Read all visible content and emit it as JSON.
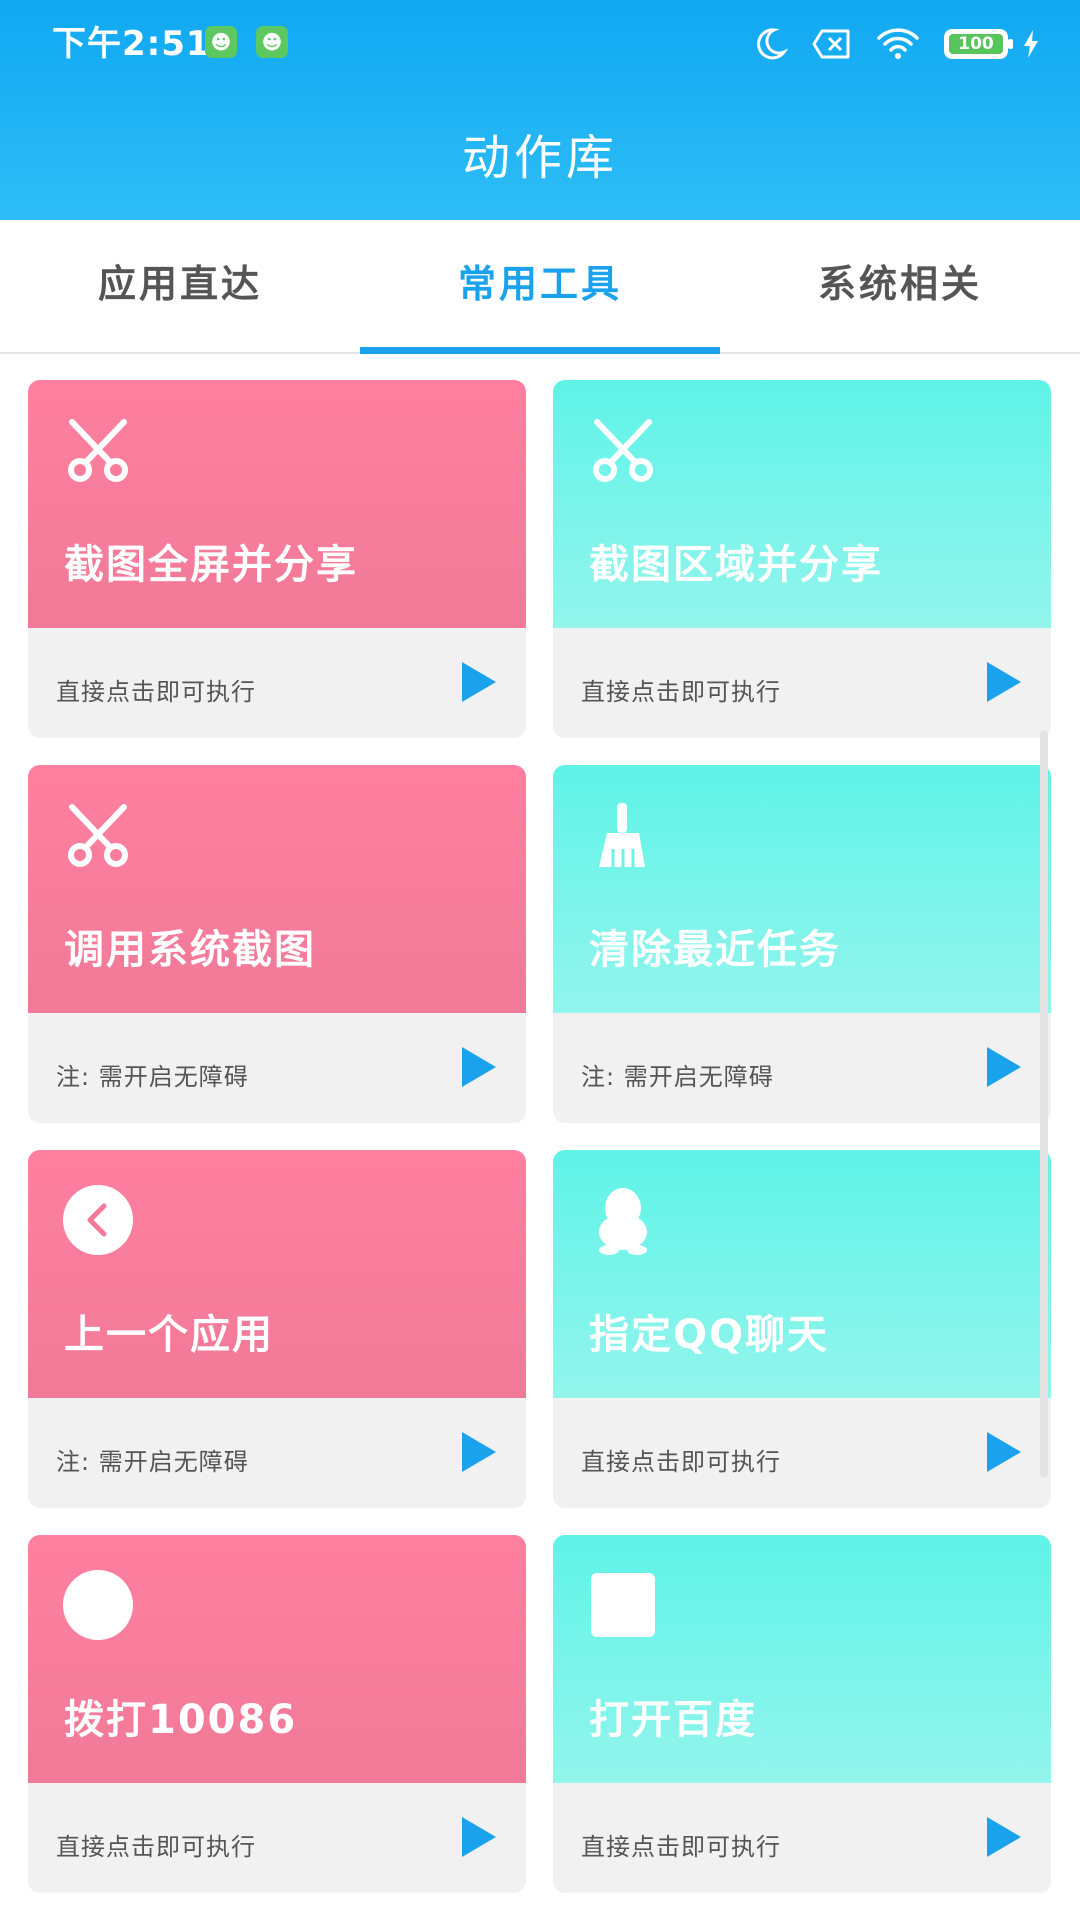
{
  "status_bar": {
    "time": "下午2:51",
    "battery": "100"
  },
  "header": {
    "title": "动作库"
  },
  "tabs": [
    {
      "label": "应用直达"
    },
    {
      "label": "常用工具"
    },
    {
      "label": "系统相关"
    }
  ],
  "colors": {
    "header": "#1aa3ec",
    "pink_card": "#ff7f9f",
    "teal_card": "#5ff3e8",
    "play_icon": "#1aa3ec",
    "active_tab": "#1aa3ec"
  },
  "cards": [
    {
      "title": "截图全屏并分享",
      "note": "直接点击即可执行",
      "icon": "scissors-icon",
      "theme": "pink"
    },
    {
      "title": "截图区域并分享",
      "note": "直接点击即可执行",
      "icon": "scissors-icon",
      "theme": "teal"
    },
    {
      "title": "调用系统截图",
      "note": "注: 需开启无障碍",
      "icon": "scissors-icon",
      "theme": "pink"
    },
    {
      "title": "清除最近任务",
      "note": "注: 需开启无障碍",
      "icon": "broom-icon",
      "theme": "teal"
    },
    {
      "title": "上一个应用",
      "note": "注: 需开启无障碍",
      "icon": "back-arrow-icon",
      "theme": "pink"
    },
    {
      "title": "指定QQ聊天",
      "note": "直接点击即可执行",
      "icon": "qq-penguin-icon",
      "theme": "teal"
    },
    {
      "title": "拨打10086",
      "note": "直接点击即可执行",
      "icon": "circle-icon",
      "theme": "pink"
    },
    {
      "title": "打开百度",
      "note": "直接点击即可执行",
      "icon": "square-icon",
      "theme": "teal"
    }
  ]
}
